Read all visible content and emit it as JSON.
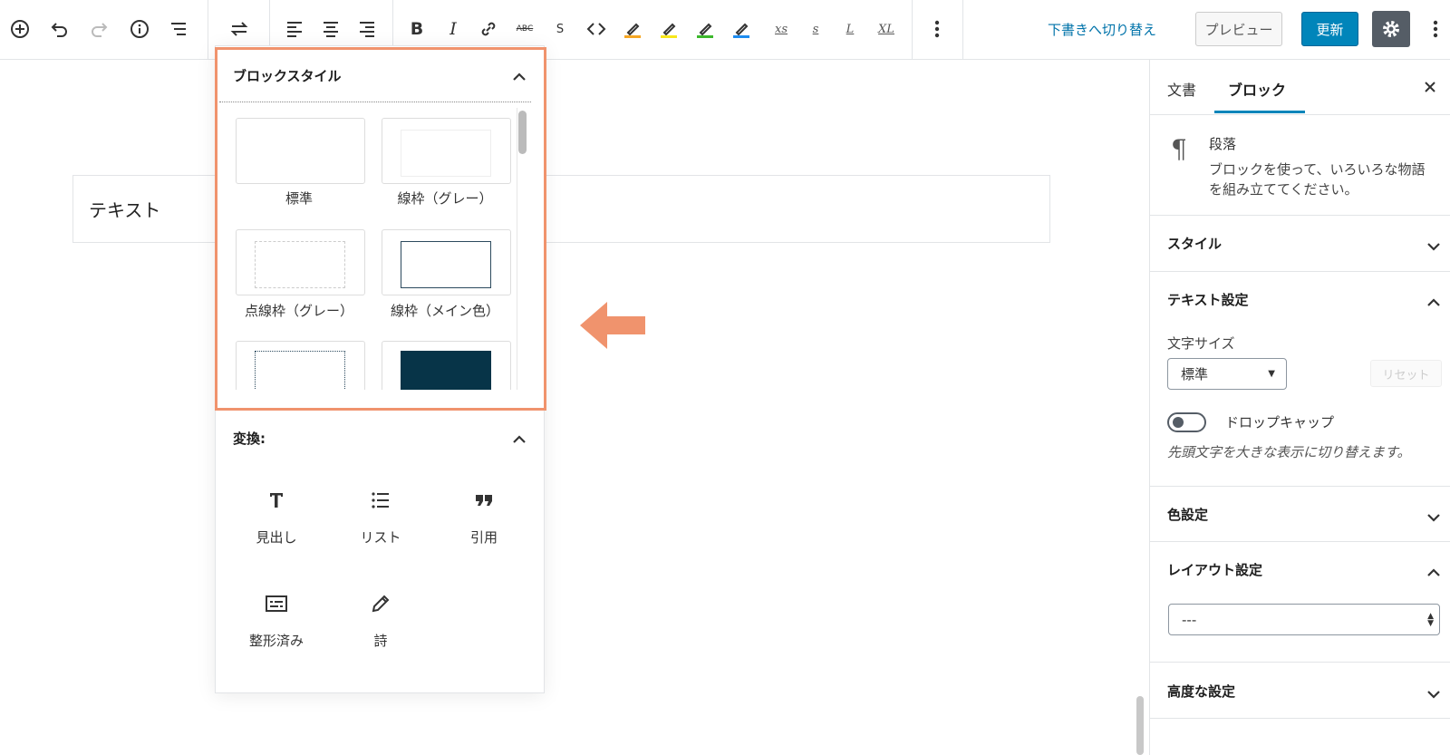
{
  "toolbar": {
    "items": [
      "add-block",
      "undo",
      "redo",
      "info",
      "outline",
      "transform",
      "align-left",
      "align-center",
      "align-right",
      "bold",
      "italic",
      "link",
      "strikethrough",
      "s",
      "code",
      "marker-orange",
      "marker-yellow",
      "marker-green",
      "marker-blue",
      "xs",
      "s-small",
      "l",
      "xl",
      "more"
    ],
    "strike_label": "ABC",
    "s_label": "S",
    "xs_label": "xs",
    "s2_label": "s",
    "l_label": "L",
    "xl_label": "XL",
    "draft_link": "下書きへ切り替え",
    "preview": "プレビュー",
    "update": "更新",
    "colors": {
      "orange": "#f5a623",
      "yellow": "#f8e71c",
      "green": "#3cb82c",
      "blue": "#1e8cf0"
    }
  },
  "editor": {
    "paragraph_text": "テキスト"
  },
  "popover": {
    "block_styles_title": "ブロックスタイル",
    "styles": [
      {
        "label": "標準"
      },
      {
        "label": "線枠（グレー）"
      },
      {
        "label": "点線枠（グレー）"
      },
      {
        "label": "線枠（メイン色）"
      },
      {
        "label": ""
      },
      {
        "label": ""
      }
    ],
    "transform_title": "変換:",
    "transforms": [
      {
        "label": "見出し",
        "icon": "heading-icon"
      },
      {
        "label": "リスト",
        "icon": "list-icon"
      },
      {
        "label": "引用",
        "icon": "quote-icon"
      },
      {
        "label": "整形済み",
        "icon": "preformatted-icon"
      },
      {
        "label": "詩",
        "icon": "verse-icon"
      }
    ],
    "accent_color": "#f0936d"
  },
  "sidebar": {
    "tabs": [
      "文書",
      "ブロック"
    ],
    "block_name": "段落",
    "block_desc_line1": "ブロックを使って、いろいろな物語",
    "block_desc_line2": "を組み立ててください。",
    "sections": {
      "style": "スタイル",
      "text_settings": "テキスト設定",
      "font_size_label": "文字サイズ",
      "font_size_value": "標準",
      "reset": "リセット",
      "dropcap": "ドロップキャップ",
      "dropcap_help": "先頭文字を大きな表示に切り替えます。",
      "color": "色設定",
      "layout": "レイアウト設定",
      "layout_value": "---",
      "advanced": "高度な設定"
    }
  }
}
